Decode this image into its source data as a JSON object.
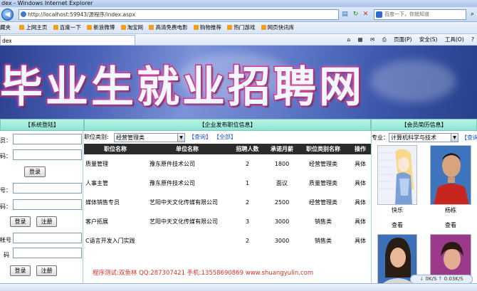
{
  "browser": {
    "title": "dex - Windows Internet Explorer",
    "url": "http://localhost:59943/源程序/index.aspx",
    "search_placeholder": "百度一下，你就知道",
    "favorites": [
      "藏夹",
      "上网主页",
      "百度一下",
      "新浪微博",
      "淘宝网",
      "高清免费电影",
      "购物推荐",
      "热门游戏",
      "网页快讯库"
    ],
    "tab_label": "dex",
    "commands": [
      "页面(P)",
      "安全(S)",
      "工具(O)"
    ]
  },
  "banner": {
    "title": "毕业生就业招聘网"
  },
  "login": {
    "header": "【系统登陆】",
    "label_user": "员：",
    "label_pwd": "码：",
    "login_btn": "登录",
    "label_no": "号：",
    "label_pwd2": "码：",
    "login_btn2": "登录",
    "register_btn2": "注册",
    "label_account": "帐号",
    "label_pwd3": "码",
    "login_btn3": "登录",
    "register_btn3": "注册"
  },
  "jobs": {
    "header": "【企业发布职位信息】",
    "filter_label": "职位类别:",
    "filter_value": "经营管理类",
    "query_link": "【查询】",
    "all_link": "【全部】",
    "columns": [
      "职位名称",
      "单位名称",
      "招聘人数",
      "承诺月薪",
      "职位类别名称",
      "操作"
    ],
    "rows": [
      [
        "质量管理",
        "豫东原件技术公司",
        "2",
        "1800",
        "经营管理类",
        "具体"
      ],
      [
        "人事主管",
        "豫东原件技术公司",
        "1",
        "面议",
        "质量管理类",
        "具体"
      ],
      [
        "媒体销售专员",
        "艺阳中天文化传媒有限公司",
        "2",
        "2500",
        "经营管理类",
        "具体"
      ],
      [
        "客户拓展",
        "艺阳中天文化传媒有限公司",
        "3",
        "3000",
        "销售类",
        "具体"
      ],
      [
        "C语言开发入门实践",
        "",
        "2",
        "3000",
        "销售类",
        "具体"
      ]
    ],
    "credit": "程序测试:双鱼林 QQ:287307421 手机:13558690869 www.shuangyulin.com"
  },
  "members": {
    "header": "【会员简历信息】",
    "filter_label": "专业：",
    "filter_value": "计算机科学与技术",
    "query_link": "【查询",
    "cards": [
      {
        "name": "快乐",
        "view": "查看"
      },
      {
        "name": "杨栋",
        "view": "查看"
      }
    ]
  },
  "status": {
    "speed_label": "0K/S",
    "speed_label2": "0.03K/S"
  }
}
